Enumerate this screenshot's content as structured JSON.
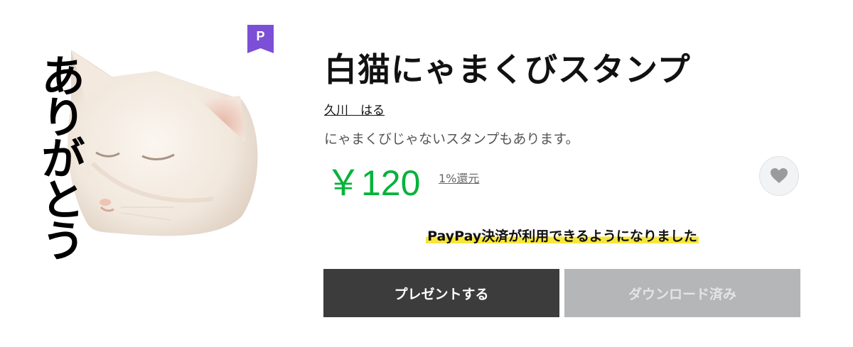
{
  "sticker": {
    "text": "ありがとう",
    "image": "white-cat-sleeping-face"
  },
  "premium_badge": {
    "label": "P",
    "color": "#7b4fd6"
  },
  "product": {
    "title": "白猫にゃまくびスタンプ",
    "author": "久川　はる",
    "description": "にゃまくびじゃないスタンプもあります。",
    "price": "￥120",
    "cashback": "1%還元",
    "price_color": "#06b33a"
  },
  "favorite": {
    "icon": "heart-icon"
  },
  "notice": {
    "text": "PayPay決済が利用できるようになりました",
    "highlight_color": "#f7e63a"
  },
  "buttons": {
    "present_label": "プレゼントする",
    "download_label": "ダウンロード済み"
  }
}
